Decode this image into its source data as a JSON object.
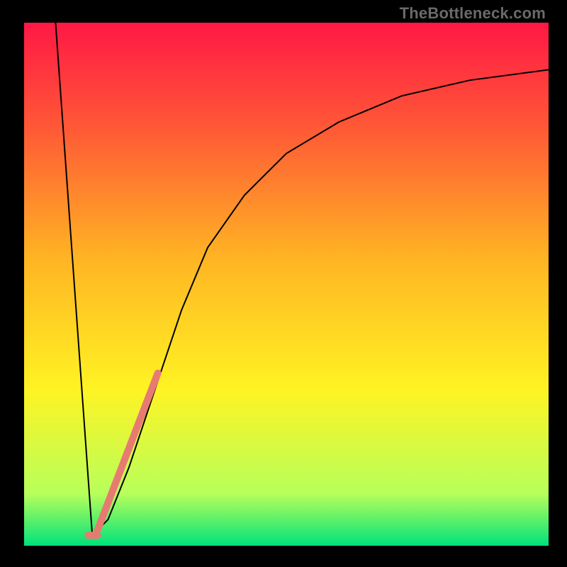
{
  "watermark": {
    "text": "TheBottleneck.com"
  },
  "chart_data": {
    "type": "line",
    "title": "",
    "xlabel": "",
    "ylabel": "",
    "xlim": [
      0,
      100
    ],
    "ylim": [
      0,
      100
    ],
    "background_gradient": {
      "stops": [
        {
          "pos": 0.0,
          "color": "#ff1845"
        },
        {
          "pos": 0.2,
          "color": "#ff5836"
        },
        {
          "pos": 0.45,
          "color": "#ffb423"
        },
        {
          "pos": 0.7,
          "color": "#fff323"
        },
        {
          "pos": 0.9,
          "color": "#b8ff5a"
        },
        {
          "pos": 1.0,
          "color": "#00e27a"
        }
      ]
    },
    "series": [
      {
        "name": "left-spike",
        "color": "#000000",
        "width": 2,
        "points": [
          {
            "x": 6.0,
            "y": 100.0
          },
          {
            "x": 13.0,
            "y": 2.0
          }
        ]
      },
      {
        "name": "rising-curve",
        "color": "#000000",
        "width": 2,
        "points": [
          {
            "x": 13.0,
            "y": 2.0
          },
          {
            "x": 16.0,
            "y": 5.0
          },
          {
            "x": 20.0,
            "y": 15.0
          },
          {
            "x": 25.0,
            "y": 30.0
          },
          {
            "x": 30.0,
            "y": 45.0
          },
          {
            "x": 35.0,
            "y": 57.0
          },
          {
            "x": 42.0,
            "y": 67.0
          },
          {
            "x": 50.0,
            "y": 75.0
          },
          {
            "x": 60.0,
            "y": 81.0
          },
          {
            "x": 72.0,
            "y": 86.0
          },
          {
            "x": 85.0,
            "y": 89.0
          },
          {
            "x": 100.0,
            "y": 91.0
          }
        ]
      },
      {
        "name": "highlight-segment",
        "color": "#e77b72",
        "width": 10,
        "linecap": "round",
        "points": [
          {
            "x": 14.0,
            "y": 3.0
          },
          {
            "x": 25.5,
            "y": 33.0
          }
        ]
      },
      {
        "name": "highlight-dot",
        "color": "#e77b72",
        "width": 10,
        "linecap": "round",
        "points": [
          {
            "x": 12.2,
            "y": 2.0
          },
          {
            "x": 14.0,
            "y": 2.0
          }
        ]
      }
    ]
  }
}
